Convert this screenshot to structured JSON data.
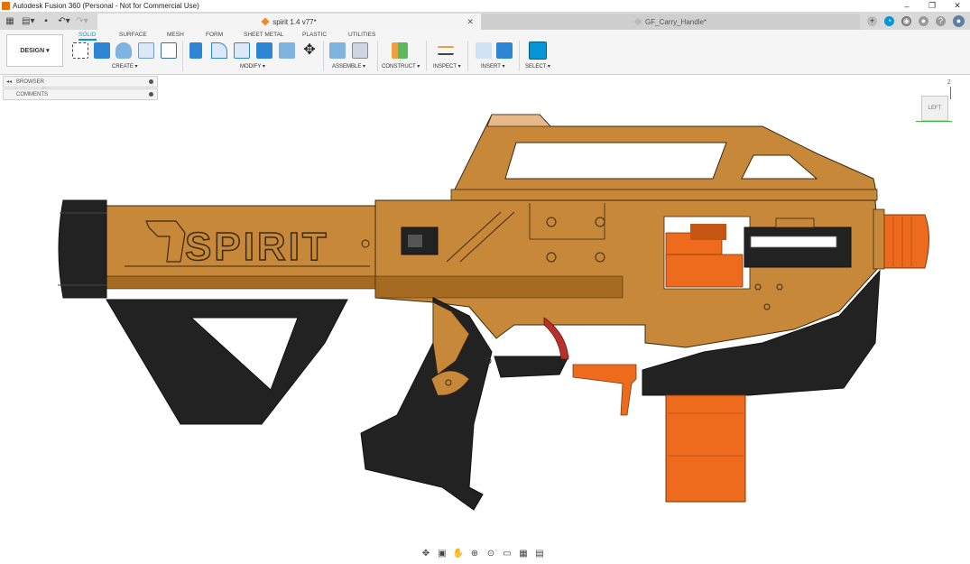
{
  "app": {
    "window_title": "Autodesk Fusion 360 (Personal - Not for Commercial Use)",
    "window_controls": {
      "minimize": "–",
      "restore": "❐",
      "close": "✕"
    }
  },
  "tabs": {
    "active": {
      "label": "spirit 1.4 v77*",
      "close": "✕"
    },
    "inactive": {
      "label": "GF_Carry_Handle*"
    }
  },
  "toolbar": {
    "workspace_button": "DESIGN ▾",
    "workspace_tabs": [
      "SOLID",
      "SURFACE",
      "MESH",
      "FORM",
      "SHEET METAL",
      "PLASTIC",
      "UTILITIES"
    ],
    "groups": [
      "CREATE ▾",
      "MODIFY ▾",
      "ASSEMBLE ▾",
      "CONSTRUCT ▾",
      "INSPECT ▾",
      "INSERT ▾",
      "SELECT ▾"
    ]
  },
  "panels": {
    "browser": "BROWSER",
    "comments": "COMMENTS"
  },
  "viewcube": {
    "face": "LEFT",
    "axis": "Z"
  },
  "model": {
    "stock_text": "SPIRIT"
  },
  "colors": {
    "accent": "#0696d7",
    "body_tan": "#c7883a",
    "body_shadow": "#a66a22",
    "black_parts": "#222222",
    "orange_parts": "#ee6a1c"
  }
}
